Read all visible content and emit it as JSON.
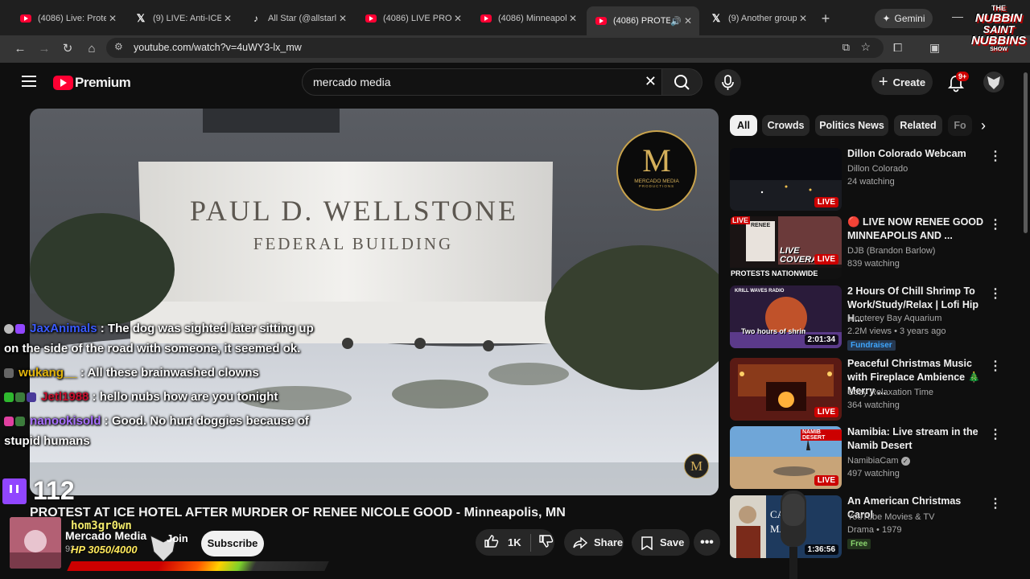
{
  "browser": {
    "tabs": [
      {
        "icon": "youtube-icon",
        "title": "(4086) Live: Protest"
      },
      {
        "icon": "x-icon",
        "title": "(9) LIVE: Anti-ICE D"
      },
      {
        "icon": "tiktok-icon",
        "title": "All Star (@allstarliv"
      },
      {
        "icon": "youtube-icon",
        "title": "(4086) LIVE PROTE"
      },
      {
        "icon": "youtube-icon",
        "title": "(4086) Minneapolis"
      },
      {
        "icon": "youtube-icon",
        "title": "(4086) PROTES"
      },
      {
        "icon": "x-icon",
        "title": "(9) Another group"
      }
    ],
    "gemini_label": "Gemini",
    "url": "youtube.com/watch?v=4uWY3-lx_mw"
  },
  "youtube": {
    "logo_text": "Premium",
    "search_query": "mercado media",
    "create_label": "Create",
    "notif_count": "9+"
  },
  "video": {
    "sign_line1": "PAUL D. WELLSTONE",
    "sign_line2": "FEDERAL BUILDING",
    "logo_line1": "MERCADO MEDIA",
    "logo_line2": "PRODUCTIONS",
    "logo_mark": "M",
    "title": "PROTEST AT ICE HOTEL AFTER MURDER OF RENEE NICOLE GOOD - Minneapolis, MN",
    "channel": "Mercado Media",
    "subscribers": "93",
    "join_label": "Join",
    "subscribe_label": "Subscribe",
    "likes": "1K",
    "share_label": "Share",
    "save_label": "Save"
  },
  "overlay": {
    "chat": [
      {
        "user": "JaxAnimals",
        "user_color": "#3a5bff",
        "text": "The dog was sighted later sitting up on the side of the road with someone, it seemed ok."
      },
      {
        "user": "wukang__",
        "user_color": "#e3b50b",
        "text": "All these brainwashed clowns"
      },
      {
        "user": "Jetl1988",
        "user_color": "#c8102e",
        "text": "hello nubs how are you tonight"
      },
      {
        "user": "nanookisold",
        "user_color": "#a970ff",
        "text": "Good. No hurt doggies because of stupid humans"
      }
    ],
    "viewer_count": "112",
    "streamer": "hom3gr0wn",
    "hp_text": "HP 3050/4000",
    "hp_fraction": 0.7625,
    "show_logo": [
      "THE",
      "NUBBIN",
      "SAINT",
      "NUBBINS",
      "SHOW"
    ]
  },
  "filters": [
    "All",
    "Crowds",
    "Politics News",
    "Related",
    "Fo"
  ],
  "recommendations": [
    {
      "title": "Dillon Colorado Webcam",
      "channel": "Dillon Colorado",
      "meta": "24 watching",
      "badge": "LIVE"
    },
    {
      "title": "🔴 LIVE NOW RENEE GOOD MINNEAPOLIS AND ...",
      "channel": "DJB (Brandon Barlow)",
      "meta": "839 watching",
      "badge": "LIVE"
    },
    {
      "title": "2 Hours Of Chill Shrimp To Work/Study/Relax | Lofi Hip H...",
      "channel": "Monterey Bay Aquarium",
      "meta": "2.2M views • 3 years ago",
      "badge": "2:01:34",
      "tag": "Fundraiser"
    },
    {
      "title": "Peaceful Christmas Music with Fireplace Ambience 🎄Merry ...",
      "channel": "Cozy Relaxation Time",
      "meta": "364 watching",
      "badge": "LIVE"
    },
    {
      "title": "Namibia: Live stream in the Namib Desert",
      "channel": "NamibiaCam",
      "meta": "497 watching",
      "badge": "LIVE"
    },
    {
      "title": "An American Christmas Carol",
      "channel": "YouTube Movies & TV",
      "meta": "Drama • 1979",
      "badge": "1:36:56",
      "tag": "Free"
    }
  ],
  "thumb_text": {
    "live_tag": "LIVE",
    "renee": "RENEE",
    "live_coverage": "LIVE COVERAGE",
    "protests": "PROTESTS NATIONWIDE",
    "krill": "KRILL WAVES RADIO",
    "shrimp": "Two hours of shrimp lofi",
    "namib": "NAMIB DESERT",
    "can": "CAN",
    "mas": "MAS"
  }
}
